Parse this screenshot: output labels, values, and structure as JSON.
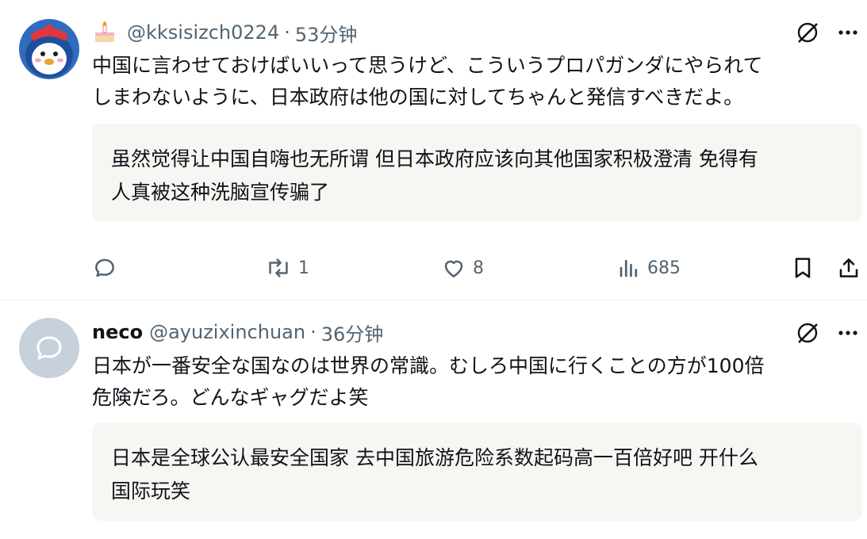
{
  "tweets": [
    {
      "display_name": "",
      "handle": "@kksisizch0224",
      "separator": "·",
      "time": "53分钟",
      "text_lines": [
        "中国に言わせておけばいいって思うけど、こういうプロパガンダにやられて",
        "しまわないように、日本政府は他の国に対してちゃんと発信すべきだよ。"
      ],
      "translation_lines": [
        "虽然觉得让中国自嗨也无所谓 但日本政府应该向其他国家积极澄清 免得有",
        "人真被这种洗脑宣传骗了"
      ],
      "actions": {
        "reply_count": "",
        "retweet_count": "1",
        "like_count": "8",
        "views_count": "685"
      }
    },
    {
      "display_name": "neco",
      "handle": "@ayuzixinchuan",
      "separator": "·",
      "time": "36分钟",
      "text_lines": [
        "日本が一番安全な国なのは世界の常識。むしろ中国に行くことの方が100倍",
        "危険だろ。どんなギャグだよ笑"
      ],
      "translation_lines": [
        "日本是全球公认最安全国家 去中国旅游危险系数起码高一百倍好吧 开什么",
        "国际玩笑"
      ]
    }
  ],
  "icons": {
    "header_emoji": "cake-emoji-icon",
    "grok": "grok-icon",
    "more": "more-icon",
    "reply": "reply-icon",
    "retweet": "retweet-icon",
    "like": "heart-icon",
    "views": "views-icon",
    "bookmark": "bookmark-icon",
    "share": "share-icon"
  },
  "colors": {
    "secondary_text": "#536471",
    "translation_bg": "#f7f6f3",
    "avatar2_bg": "#c7d1dc"
  }
}
